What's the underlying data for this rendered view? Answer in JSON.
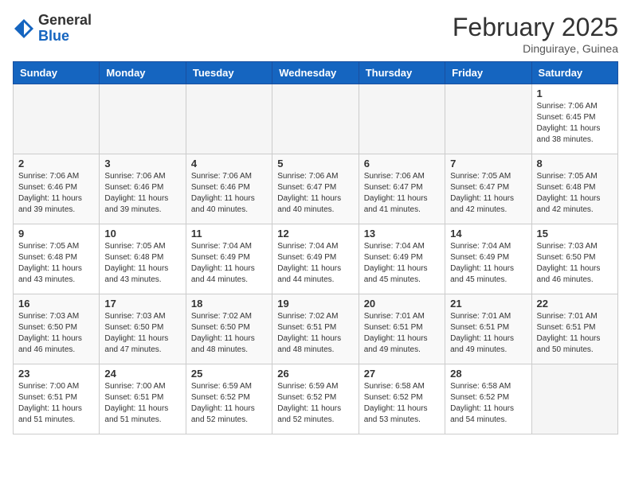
{
  "header": {
    "logo": {
      "general": "General",
      "blue": "Blue"
    },
    "month_title": "February 2025",
    "subtitle": "Dinguiraye, Guinea"
  },
  "weekdays": [
    "Sunday",
    "Monday",
    "Tuesday",
    "Wednesday",
    "Thursday",
    "Friday",
    "Saturday"
  ],
  "weeks": [
    [
      {
        "day": "",
        "info": ""
      },
      {
        "day": "",
        "info": ""
      },
      {
        "day": "",
        "info": ""
      },
      {
        "day": "",
        "info": ""
      },
      {
        "day": "",
        "info": ""
      },
      {
        "day": "",
        "info": ""
      },
      {
        "day": "1",
        "info": "Sunrise: 7:06 AM\nSunset: 6:45 PM\nDaylight: 11 hours\nand 38 minutes."
      }
    ],
    [
      {
        "day": "2",
        "info": "Sunrise: 7:06 AM\nSunset: 6:46 PM\nDaylight: 11 hours\nand 39 minutes."
      },
      {
        "day": "3",
        "info": "Sunrise: 7:06 AM\nSunset: 6:46 PM\nDaylight: 11 hours\nand 39 minutes."
      },
      {
        "day": "4",
        "info": "Sunrise: 7:06 AM\nSunset: 6:46 PM\nDaylight: 11 hours\nand 40 minutes."
      },
      {
        "day": "5",
        "info": "Sunrise: 7:06 AM\nSunset: 6:47 PM\nDaylight: 11 hours\nand 40 minutes."
      },
      {
        "day": "6",
        "info": "Sunrise: 7:06 AM\nSunset: 6:47 PM\nDaylight: 11 hours\nand 41 minutes."
      },
      {
        "day": "7",
        "info": "Sunrise: 7:05 AM\nSunset: 6:47 PM\nDaylight: 11 hours\nand 42 minutes."
      },
      {
        "day": "8",
        "info": "Sunrise: 7:05 AM\nSunset: 6:48 PM\nDaylight: 11 hours\nand 42 minutes."
      }
    ],
    [
      {
        "day": "9",
        "info": "Sunrise: 7:05 AM\nSunset: 6:48 PM\nDaylight: 11 hours\nand 43 minutes."
      },
      {
        "day": "10",
        "info": "Sunrise: 7:05 AM\nSunset: 6:48 PM\nDaylight: 11 hours\nand 43 minutes."
      },
      {
        "day": "11",
        "info": "Sunrise: 7:04 AM\nSunset: 6:49 PM\nDaylight: 11 hours\nand 44 minutes."
      },
      {
        "day": "12",
        "info": "Sunrise: 7:04 AM\nSunset: 6:49 PM\nDaylight: 11 hours\nand 44 minutes."
      },
      {
        "day": "13",
        "info": "Sunrise: 7:04 AM\nSunset: 6:49 PM\nDaylight: 11 hours\nand 45 minutes."
      },
      {
        "day": "14",
        "info": "Sunrise: 7:04 AM\nSunset: 6:49 PM\nDaylight: 11 hours\nand 45 minutes."
      },
      {
        "day": "15",
        "info": "Sunrise: 7:03 AM\nSunset: 6:50 PM\nDaylight: 11 hours\nand 46 minutes."
      }
    ],
    [
      {
        "day": "16",
        "info": "Sunrise: 7:03 AM\nSunset: 6:50 PM\nDaylight: 11 hours\nand 46 minutes."
      },
      {
        "day": "17",
        "info": "Sunrise: 7:03 AM\nSunset: 6:50 PM\nDaylight: 11 hours\nand 47 minutes."
      },
      {
        "day": "18",
        "info": "Sunrise: 7:02 AM\nSunset: 6:50 PM\nDaylight: 11 hours\nand 48 minutes."
      },
      {
        "day": "19",
        "info": "Sunrise: 7:02 AM\nSunset: 6:51 PM\nDaylight: 11 hours\nand 48 minutes."
      },
      {
        "day": "20",
        "info": "Sunrise: 7:01 AM\nSunset: 6:51 PM\nDaylight: 11 hours\nand 49 minutes."
      },
      {
        "day": "21",
        "info": "Sunrise: 7:01 AM\nSunset: 6:51 PM\nDaylight: 11 hours\nand 49 minutes."
      },
      {
        "day": "22",
        "info": "Sunrise: 7:01 AM\nSunset: 6:51 PM\nDaylight: 11 hours\nand 50 minutes."
      }
    ],
    [
      {
        "day": "23",
        "info": "Sunrise: 7:00 AM\nSunset: 6:51 PM\nDaylight: 11 hours\nand 51 minutes."
      },
      {
        "day": "24",
        "info": "Sunrise: 7:00 AM\nSunset: 6:51 PM\nDaylight: 11 hours\nand 51 minutes."
      },
      {
        "day": "25",
        "info": "Sunrise: 6:59 AM\nSunset: 6:52 PM\nDaylight: 11 hours\nand 52 minutes."
      },
      {
        "day": "26",
        "info": "Sunrise: 6:59 AM\nSunset: 6:52 PM\nDaylight: 11 hours\nand 52 minutes."
      },
      {
        "day": "27",
        "info": "Sunrise: 6:58 AM\nSunset: 6:52 PM\nDaylight: 11 hours\nand 53 minutes."
      },
      {
        "day": "28",
        "info": "Sunrise: 6:58 AM\nSunset: 6:52 PM\nDaylight: 11 hours\nand 54 minutes."
      },
      {
        "day": "",
        "info": ""
      }
    ]
  ]
}
